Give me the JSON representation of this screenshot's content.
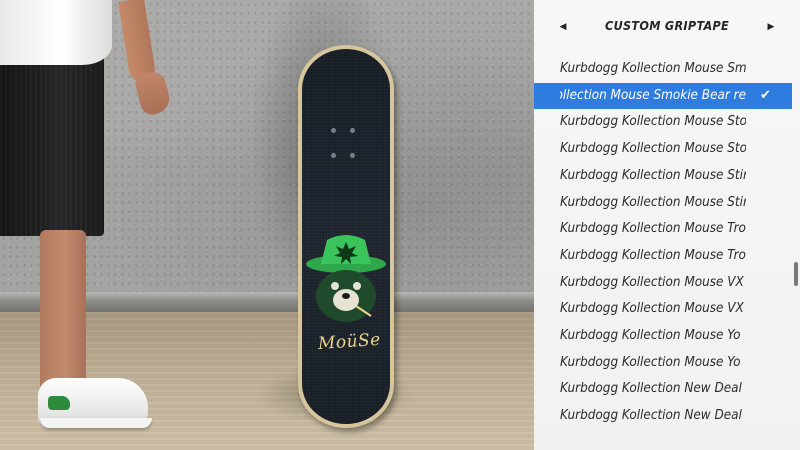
{
  "panel": {
    "title": "CUSTOM GRIPTAPE",
    "prev_icon": "caret-left-icon",
    "next_icon": "caret-right-icon",
    "selected_index": 1,
    "check_icon": "checkmark-icon",
    "accent_color": "#2f7ce0",
    "items": [
      {
        "label": "Kurbdogg Kollection Mouse Sm"
      },
      {
        "label": "Kollection Mouse Smokie Bear re"
      },
      {
        "label": "Kurbdogg Kollection Mouse Sto"
      },
      {
        "label": "Kurbdogg Kollection Mouse Sto"
      },
      {
        "label": "Kurbdogg Kollection Mouse Stir"
      },
      {
        "label": "Kurbdogg Kollection Mouse Stir"
      },
      {
        "label": "Kurbdogg Kollection Mouse Tro"
      },
      {
        "label": "Kurbdogg Kollection Mouse Tro"
      },
      {
        "label": "Kurbdogg Kollection Mouse VX"
      },
      {
        "label": "Kurbdogg Kollection Mouse VX"
      },
      {
        "label": "Kurbdogg Kollection Mouse Yo"
      },
      {
        "label": "Kurbdogg Kollection Mouse Yo"
      },
      {
        "label": "Kurbdogg Kollection New Deal"
      },
      {
        "label": "Kurbdogg Kollection New Deal"
      }
    ]
  },
  "scene": {
    "board_graphic_text": "MoüSe",
    "board_graphic_colors": {
      "grip": "#151b23",
      "hat": "#2ea84a",
      "face": "#1e2a2a",
      "text": "#e8d58a"
    }
  }
}
